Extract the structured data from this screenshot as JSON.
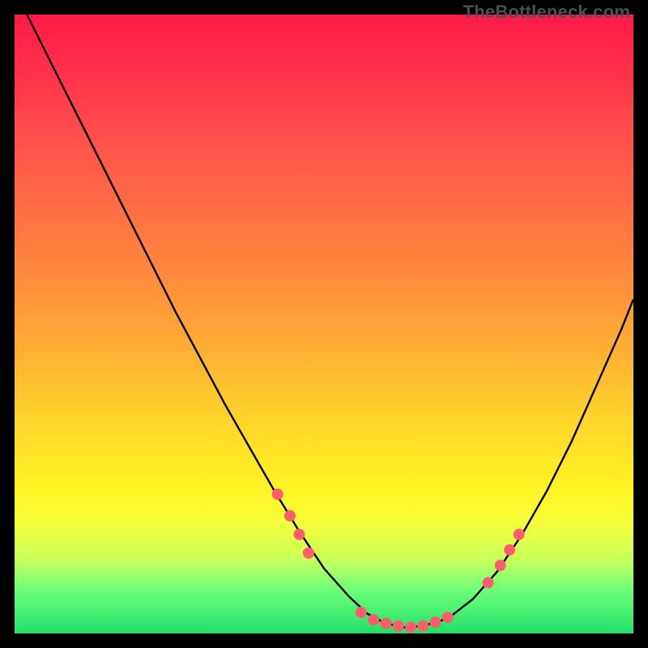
{
  "watermark": "TheBottleneck.com",
  "chart_data": {
    "type": "line",
    "title": "",
    "xlabel": "",
    "ylabel": "",
    "xlim": [
      0,
      100
    ],
    "ylim": [
      0,
      100
    ],
    "series": [
      {
        "name": "bottleneck-curve",
        "x": [
          2,
          6,
          10,
          14,
          18,
          22,
          26,
          30,
          34,
          38,
          42,
          46,
          50,
          54,
          57,
          60,
          63,
          66,
          70,
          74,
          78,
          82,
          86,
          90,
          94,
          98,
          100
        ],
        "y": [
          100,
          92,
          84,
          76,
          68,
          60,
          52,
          44.5,
          37,
          30,
          23,
          16.5,
          10.5,
          6,
          3.2,
          1.6,
          1.0,
          1.2,
          2.4,
          5.5,
          10,
          16,
          23,
          31,
          40,
          49,
          54
        ]
      }
    ],
    "markers": [
      {
        "x": 42.5,
        "y": 22.5
      },
      {
        "x": 44.5,
        "y": 19.0
      },
      {
        "x": 46.0,
        "y": 16.0
      },
      {
        "x": 47.5,
        "y": 13.0
      },
      {
        "x": 56.0,
        "y": 3.4
      },
      {
        "x": 58.0,
        "y": 2.2
      },
      {
        "x": 60.0,
        "y": 1.6
      },
      {
        "x": 62.0,
        "y": 1.2
      },
      {
        "x": 64.0,
        "y": 1.0
      },
      {
        "x": 66.0,
        "y": 1.2
      },
      {
        "x": 68.0,
        "y": 1.8
      },
      {
        "x": 70.0,
        "y": 2.6
      },
      {
        "x": 76.5,
        "y": 8.2
      },
      {
        "x": 78.5,
        "y": 11.0
      },
      {
        "x": 80.0,
        "y": 13.5
      },
      {
        "x": 81.5,
        "y": 16.0
      }
    ],
    "marker_color": "#ff5d6c",
    "line_color": "#000000"
  }
}
